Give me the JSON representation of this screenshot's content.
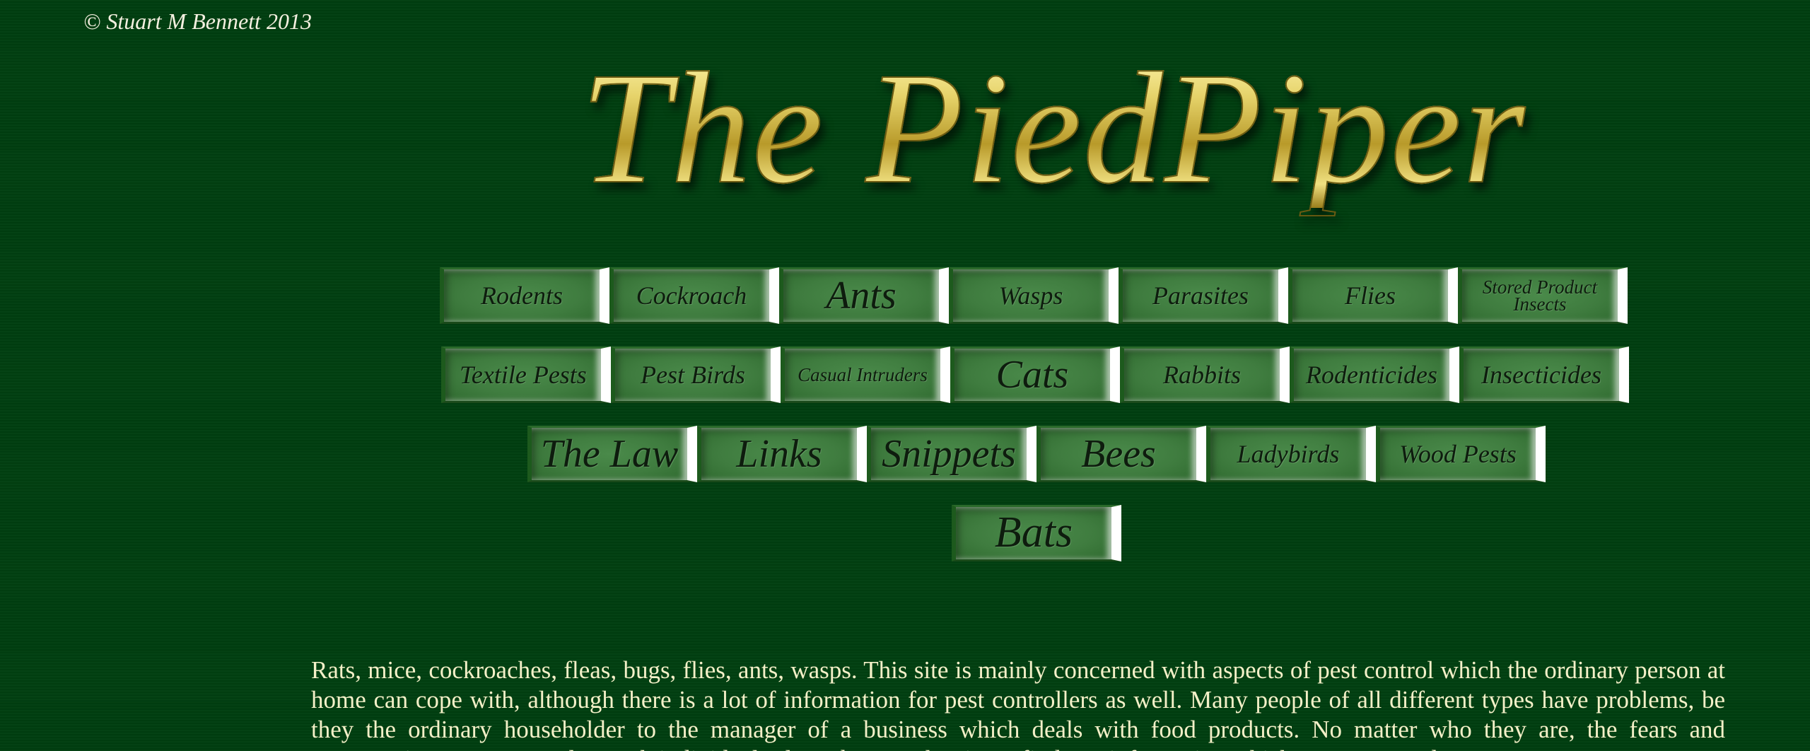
{
  "copyright": "© Stuart M Bennett 2013",
  "logo": {
    "text": "The PiedPiper"
  },
  "nav": {
    "row1": [
      {
        "label": "Rodents"
      },
      {
        "label": "Cockroach"
      },
      {
        "label": "Ants"
      },
      {
        "label": "Wasps"
      },
      {
        "label": "Parasites"
      },
      {
        "label": "Flies"
      },
      {
        "label": "Stored Product Insects"
      }
    ],
    "row2": [
      {
        "label": "Textile Pests"
      },
      {
        "label": "Pest Birds"
      },
      {
        "label": "Casual Intruders"
      },
      {
        "label": "Cats"
      },
      {
        "label": "Rabbits"
      },
      {
        "label": "Rodenticides"
      },
      {
        "label": "Insecticides"
      }
    ],
    "row3": [
      {
        "label": "The Law"
      },
      {
        "label": "Links"
      },
      {
        "label": "Snippets"
      },
      {
        "label": "Bees"
      },
      {
        "label": "Ladybirds"
      },
      {
        "label": "Wood Pests"
      }
    ],
    "row4": [
      {
        "label": "Bats"
      }
    ]
  },
  "intro": {
    "text": "Rats, mice, cockroaches, fleas, bugs, flies, ants, wasps. This site is mainly concerned with aspects of pest control which the ordinary person at home can cope with, although there is a lot of information for pest controllers as well. Many people of all different types have problems, be they the ordinary householder to the manager of a business which deals with food products. No matter who they are, the fears and repercussions are very real to each individual. Please browse the site to find any information which you may need. Hope you"
  },
  "colors": {
    "background": "#003f10",
    "text": "#f4f0c8",
    "button": "#3f7c3f",
    "logo_gold": "#d8c860"
  }
}
